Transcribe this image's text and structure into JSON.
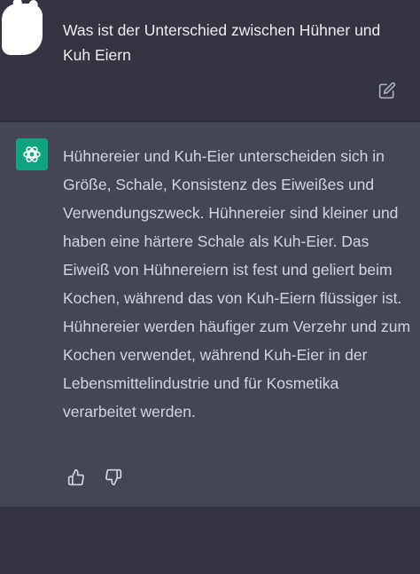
{
  "conversation": {
    "user_message": "Was ist der Unterschied zwischen Hühner und Kuh Eiern",
    "assistant_message": "Hühnereier und Kuh-Eier unterscheiden sich in Größe, Schale, Konsistenz des Eiweißes und Verwendungszweck. Hühnereier sind kleiner und haben eine härtere Schale als Kuh-Eier. Das Eiweiß von Hühnereiern ist fest und geliert beim Kochen, während das von Kuh-Eiern flüssiger ist. Hühnereier werden häufiger zum Verzehr und zum Kochen verwendet, während Kuh-Eier in der Lebensmittelindustrie und für Kosmetika verarbeitet werden."
  },
  "icons": {
    "edit": "edit-icon",
    "assistant_avatar": "openai-logo-icon",
    "thumbs_up": "thumbs-up-icon",
    "thumbs_down": "thumbs-down-icon"
  },
  "colors": {
    "background": "#343541",
    "assistant_background": "#444654",
    "avatar_green": "#10a37f",
    "text": "#ececf1"
  }
}
